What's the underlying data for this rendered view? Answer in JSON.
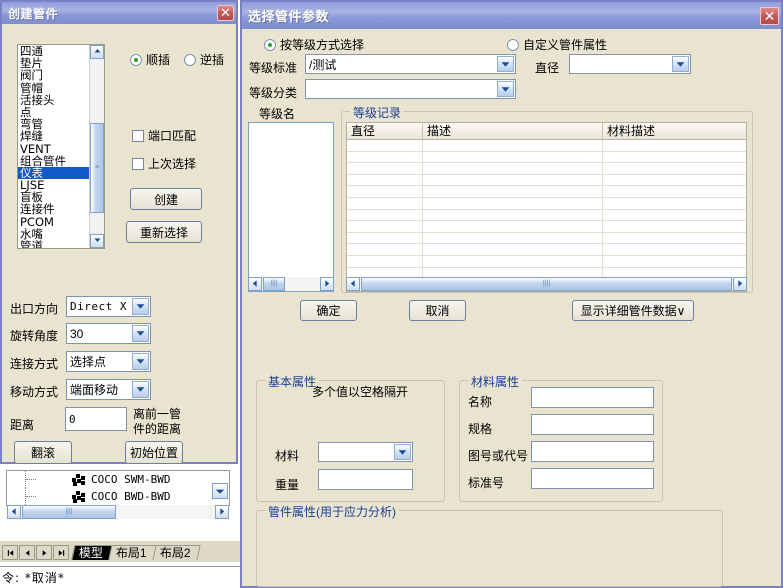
{
  "colors": {
    "window_face": "#e8e4d0",
    "window_border": "#7b7fc4",
    "title_gradient_top": "#8f9ddb",
    "title_gradient_bottom": "#7e8dd0",
    "group_title": "#1c3f96",
    "selection": "#1158c9",
    "close_button": "#c25a5a"
  },
  "create_dialog": {
    "title": "创建管件",
    "close_label": "✕",
    "component_list": {
      "items": [
        "四通",
        "垫片",
        "阀门",
        "管帽",
        "活接头",
        "点",
        "弯管",
        "焊缝",
        "VENT",
        "组合管件",
        "仪表",
        "LJSE",
        "盲板",
        "连接件",
        "PCOM",
        "水嘴",
        "管道"
      ],
      "selected": "仪表",
      "selected_index": 10
    },
    "insert_mode": {
      "forward": {
        "label": "顺插",
        "checked": true
      },
      "reverse": {
        "label": "逆插",
        "checked": false
      }
    },
    "checkboxes": [
      {
        "label": "端口匹配",
        "checked": false
      },
      {
        "label": "上次选择",
        "checked": false
      }
    ],
    "buttons": {
      "create": "创建",
      "reselect": "重新选择",
      "roll": "翻滚",
      "init_position": "初始位置"
    },
    "fields": [
      {
        "label": "出口方向",
        "value": "Direct X",
        "type": "combo",
        "mono": true
      },
      {
        "label": "旋转角度",
        "value": "30",
        "type": "combo",
        "mono": false
      },
      {
        "label": "连接方式",
        "value": "选择点",
        "type": "combo",
        "mono": false
      },
      {
        "label": "移动方式",
        "value": "端面移动",
        "type": "combo",
        "mono": false
      },
      {
        "label": "距离",
        "value": "0",
        "type": "text",
        "mono": true
      }
    ],
    "distance_hint_line1": "离前一管",
    "distance_hint_line2": "件的距离"
  },
  "param_dialog": {
    "title": "选择管件参数",
    "close_label": "✕",
    "mode": {
      "by_grade": {
        "label": "按等级方式选择",
        "checked": true
      },
      "custom": {
        "label": "自定义管件属性",
        "checked": false
      }
    },
    "grade_standard": {
      "label": "等级标准",
      "value": "/测试"
    },
    "grade_category": {
      "label": "等级分类",
      "value": ""
    },
    "diameter": {
      "label": "直径",
      "value": ""
    },
    "grade_name": {
      "label": "等级名",
      "items": []
    },
    "grade_record": {
      "title": "等级记录",
      "columns": [
        "直径",
        "描述",
        "材料描述"
      ],
      "rows": [],
      "empty_row_count": 12
    },
    "buttons": {
      "ok": "确定",
      "cancel": "取消",
      "show_detail": "显示详细管件数据∨"
    },
    "basic_props": {
      "title": "基本属性",
      "hint": "多个值以空格隔开",
      "material": {
        "label": "材料",
        "value": ""
      },
      "weight": {
        "label": "重量",
        "value": ""
      }
    },
    "material_props": {
      "title": "材料属性",
      "fields": [
        {
          "label": "名称",
          "value": ""
        },
        {
          "label": "规格",
          "value": ""
        },
        {
          "label": "图号或代号",
          "value": ""
        },
        {
          "label": "标准号",
          "value": ""
        }
      ]
    },
    "stress_props": {
      "title": "管件属性(用于应力分析)"
    }
  },
  "background_app": {
    "tree_items": [
      "COCO SWM-BWD",
      "COCO BWD-BWD"
    ],
    "nav_buttons": [
      "⏮",
      "◀",
      "▶",
      "⏭"
    ],
    "tabs": [
      {
        "label": "模型",
        "active": true
      },
      {
        "label": "布局1",
        "active": false
      },
      {
        "label": "布局2",
        "active": false
      }
    ],
    "command_line": "令: *取消*"
  }
}
